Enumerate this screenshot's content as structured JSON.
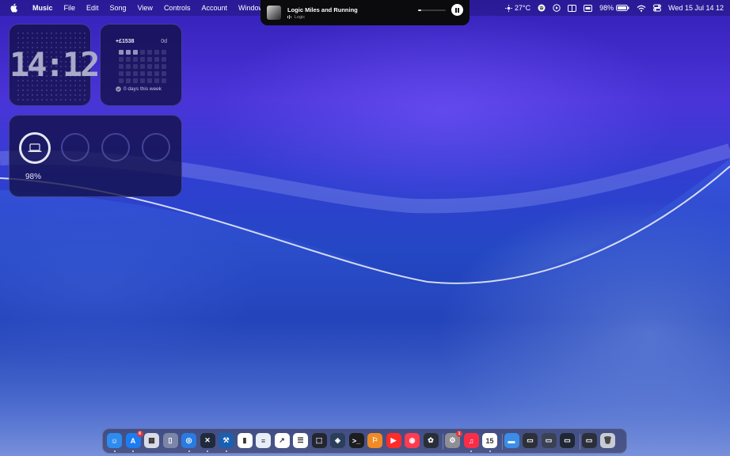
{
  "menubar": {
    "app_name": "Music",
    "items": [
      "File",
      "Edit",
      "Song",
      "View",
      "Controls",
      "Account",
      "Window"
    ],
    "weather": "27°C",
    "battery": "98%",
    "datetime": "Wed 15 Jul  14 12"
  },
  "now_playing": {
    "title": "Logic Miles and Running",
    "artist": "Logic",
    "progress": 0.1
  },
  "widgets": {
    "clock": {
      "time": "14:12"
    },
    "stats": {
      "amount": "+£1538",
      "days": "0d",
      "footer": "0 days this week"
    },
    "battery": {
      "percent": "98%",
      "level": 0.98
    }
  },
  "dock": {
    "apps": [
      {
        "name": "finder-icon",
        "color": "#2e8cf0",
        "glyph": "☺",
        "running": true
      },
      {
        "name": "app-store-icon",
        "color": "#1c7cf0",
        "glyph": "A",
        "badge": "8",
        "running": true
      },
      {
        "name": "launchpad-icon",
        "color": "#d9dbe6",
        "glyph": "▦"
      },
      {
        "name": "notes-tall-icon",
        "color": "#7b86a8",
        "glyph": "▯"
      },
      {
        "name": "safari-icon",
        "color": "#2a7be0",
        "glyph": "◎",
        "running": true
      },
      {
        "name": "vscode-icon",
        "color": "#1f2a3d",
        "glyph": "✕",
        "running": true
      },
      {
        "name": "xcode-icon",
        "color": "#1a5fb0",
        "glyph": "⚒",
        "running": true
      },
      {
        "name": "numbers-icon",
        "color": "#ffffff",
        "glyph": "▮"
      },
      {
        "name": "doc-icon",
        "color": "#e8eef8",
        "glyph": "≡"
      },
      {
        "name": "stocks-icon",
        "color": "#ffffff",
        "glyph": "↗"
      },
      {
        "name": "reminders-icon",
        "color": "#ffffff",
        "glyph": "☰"
      },
      {
        "name": "screenshot-icon",
        "color": "#23262e",
        "glyph": "⬚"
      },
      {
        "name": "layers-icon",
        "color": "#2b3f5c",
        "glyph": "◈"
      },
      {
        "name": "terminal-icon",
        "color": "#1d1d1f",
        "glyph": ">_"
      },
      {
        "name": "instruments-icon",
        "color": "#f08a24",
        "glyph": "⚐"
      },
      {
        "name": "youtube-icon",
        "color": "#ff2b2b",
        "glyph": "▶"
      },
      {
        "name": "podcast-icon",
        "color": "#ff3b50",
        "glyph": "◉"
      },
      {
        "name": "davinci-icon",
        "color": "#2a2e38",
        "glyph": "✿"
      },
      {
        "name": "system-settings-icon",
        "color": "#8e8e93",
        "glyph": "⚙",
        "badge": "1"
      },
      {
        "name": "music-icon",
        "color": "#fa2d48",
        "glyph": "♫",
        "running": true
      },
      {
        "name": "calendar-icon",
        "color": "#ffffff",
        "glyph": "15",
        "running": true
      },
      {
        "name": "downloads-folder-icon",
        "color": "#3a8ee8",
        "glyph": "▬"
      },
      {
        "name": "window-thumb-1-icon",
        "color": "#2d3038",
        "glyph": "▭"
      },
      {
        "name": "window-thumb-2-icon",
        "color": "#3a4152",
        "glyph": "▭"
      },
      {
        "name": "window-thumb-3-icon",
        "color": "#1f2734",
        "glyph": "▭"
      },
      {
        "name": "window-thumb-4-icon",
        "color": "#2c2f3a",
        "glyph": "▭"
      },
      {
        "name": "trash-icon",
        "color": "#c8ccd4",
        "glyph": "🗑"
      }
    ]
  }
}
